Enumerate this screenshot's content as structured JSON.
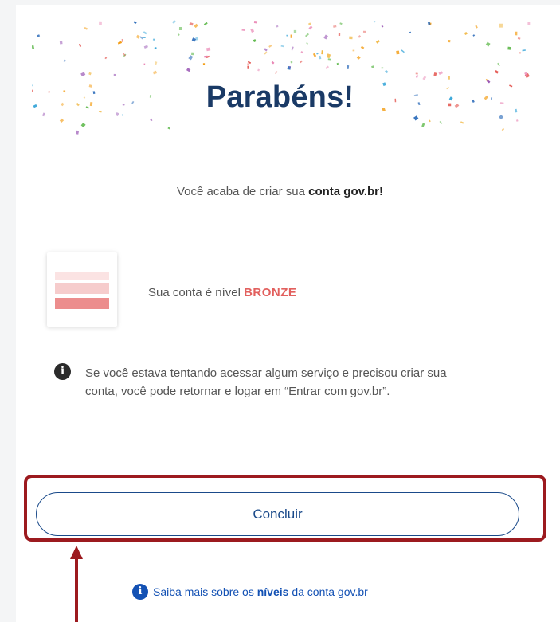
{
  "header": {
    "title": "Parabéns!"
  },
  "message": {
    "prefix": "Você acaba de criar sua ",
    "bold": "conta gov.br!"
  },
  "level": {
    "prefix": "Sua conta é nível ",
    "name": "BRONZE",
    "color": "#e2605e"
  },
  "info": {
    "text": "Se você estava tentando acessar algum serviço e precisou criar sua conta, você pode retornar e logar em “Entrar com gov.br”."
  },
  "actions": {
    "conclude_label": "Concluir"
  },
  "footer": {
    "prefix": "Saiba mais sobre os ",
    "bold": "níveis",
    "suffix": " da conta gov.br"
  },
  "colors": {
    "title": "#1a3a66",
    "primary": "#1351b4",
    "annotation": "#9c1a1f"
  },
  "icons": {
    "info": "info-icon",
    "more_info": "info-circle-icon"
  }
}
